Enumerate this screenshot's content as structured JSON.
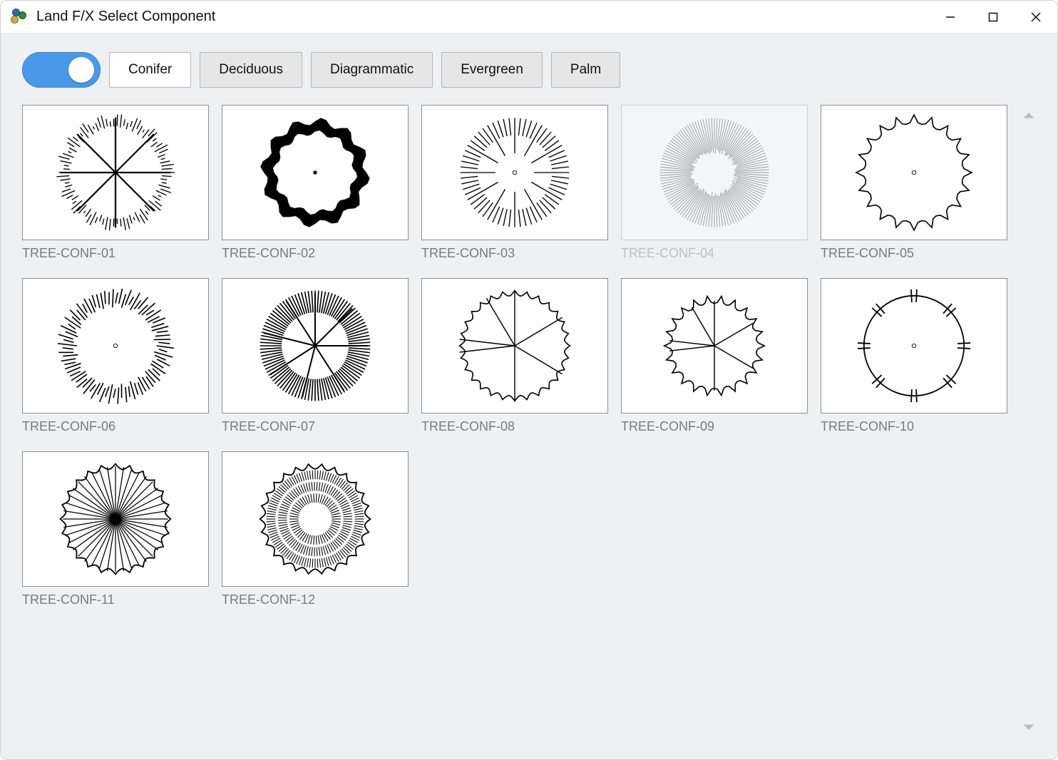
{
  "window": {
    "title": "Land F/X Select Component"
  },
  "toolbar": {
    "toggle_on": true,
    "tabs": [
      {
        "label": "Conifer",
        "active": true
      },
      {
        "label": "Deciduous",
        "active": false
      },
      {
        "label": "Diagrammatic",
        "active": false
      },
      {
        "label": "Evergreen",
        "active": false
      },
      {
        "label": "Palm",
        "active": false
      }
    ]
  },
  "components": [
    {
      "label": "TREE-CONF-01",
      "faded": false
    },
    {
      "label": "TREE-CONF-02",
      "faded": false
    },
    {
      "label": "TREE-CONF-03",
      "faded": false
    },
    {
      "label": "TREE-CONF-04",
      "faded": true
    },
    {
      "label": "TREE-CONF-05",
      "faded": false
    },
    {
      "label": "TREE-CONF-06",
      "faded": false
    },
    {
      "label": "TREE-CONF-07",
      "faded": false
    },
    {
      "label": "TREE-CONF-08",
      "faded": false
    },
    {
      "label": "TREE-CONF-09",
      "faded": false
    },
    {
      "label": "TREE-CONF-10",
      "faded": false
    },
    {
      "label": "TREE-CONF-11",
      "faded": false
    },
    {
      "label": "TREE-CONF-12",
      "faded": false
    }
  ]
}
